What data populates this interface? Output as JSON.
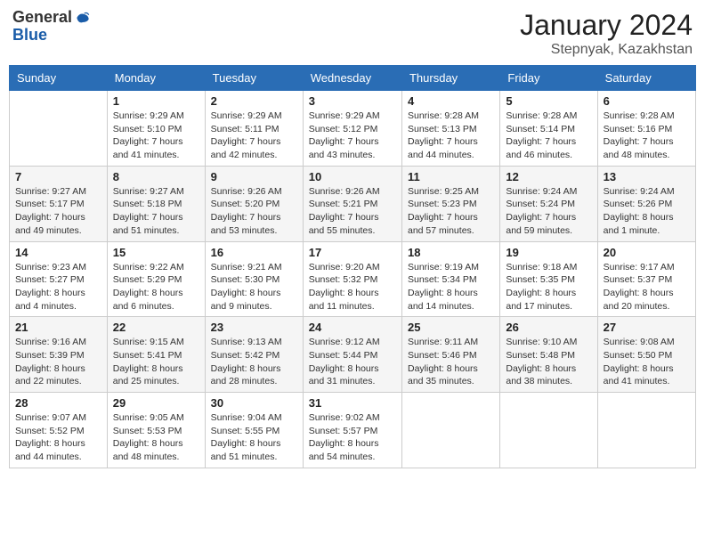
{
  "header": {
    "logo_general": "General",
    "logo_blue": "Blue",
    "month": "January 2024",
    "location": "Stepnyak, Kazakhstan"
  },
  "days_of_week": [
    "Sunday",
    "Monday",
    "Tuesday",
    "Wednesday",
    "Thursday",
    "Friday",
    "Saturday"
  ],
  "weeks": [
    [
      {
        "day": "",
        "sunrise": "",
        "sunset": "",
        "daylight": ""
      },
      {
        "day": "1",
        "sunrise": "Sunrise: 9:29 AM",
        "sunset": "Sunset: 5:10 PM",
        "daylight": "Daylight: 7 hours and 41 minutes."
      },
      {
        "day": "2",
        "sunrise": "Sunrise: 9:29 AM",
        "sunset": "Sunset: 5:11 PM",
        "daylight": "Daylight: 7 hours and 42 minutes."
      },
      {
        "day": "3",
        "sunrise": "Sunrise: 9:29 AM",
        "sunset": "Sunset: 5:12 PM",
        "daylight": "Daylight: 7 hours and 43 minutes."
      },
      {
        "day": "4",
        "sunrise": "Sunrise: 9:28 AM",
        "sunset": "Sunset: 5:13 PM",
        "daylight": "Daylight: 7 hours and 44 minutes."
      },
      {
        "day": "5",
        "sunrise": "Sunrise: 9:28 AM",
        "sunset": "Sunset: 5:14 PM",
        "daylight": "Daylight: 7 hours and 46 minutes."
      },
      {
        "day": "6",
        "sunrise": "Sunrise: 9:28 AM",
        "sunset": "Sunset: 5:16 PM",
        "daylight": "Daylight: 7 hours and 48 minutes."
      }
    ],
    [
      {
        "day": "7",
        "sunrise": "Sunrise: 9:27 AM",
        "sunset": "Sunset: 5:17 PM",
        "daylight": "Daylight: 7 hours and 49 minutes."
      },
      {
        "day": "8",
        "sunrise": "Sunrise: 9:27 AM",
        "sunset": "Sunset: 5:18 PM",
        "daylight": "Daylight: 7 hours and 51 minutes."
      },
      {
        "day": "9",
        "sunrise": "Sunrise: 9:26 AM",
        "sunset": "Sunset: 5:20 PM",
        "daylight": "Daylight: 7 hours and 53 minutes."
      },
      {
        "day": "10",
        "sunrise": "Sunrise: 9:26 AM",
        "sunset": "Sunset: 5:21 PM",
        "daylight": "Daylight: 7 hours and 55 minutes."
      },
      {
        "day": "11",
        "sunrise": "Sunrise: 9:25 AM",
        "sunset": "Sunset: 5:23 PM",
        "daylight": "Daylight: 7 hours and 57 minutes."
      },
      {
        "day": "12",
        "sunrise": "Sunrise: 9:24 AM",
        "sunset": "Sunset: 5:24 PM",
        "daylight": "Daylight: 7 hours and 59 minutes."
      },
      {
        "day": "13",
        "sunrise": "Sunrise: 9:24 AM",
        "sunset": "Sunset: 5:26 PM",
        "daylight": "Daylight: 8 hours and 1 minute."
      }
    ],
    [
      {
        "day": "14",
        "sunrise": "Sunrise: 9:23 AM",
        "sunset": "Sunset: 5:27 PM",
        "daylight": "Daylight: 8 hours and 4 minutes."
      },
      {
        "day": "15",
        "sunrise": "Sunrise: 9:22 AM",
        "sunset": "Sunset: 5:29 PM",
        "daylight": "Daylight: 8 hours and 6 minutes."
      },
      {
        "day": "16",
        "sunrise": "Sunrise: 9:21 AM",
        "sunset": "Sunset: 5:30 PM",
        "daylight": "Daylight: 8 hours and 9 minutes."
      },
      {
        "day": "17",
        "sunrise": "Sunrise: 9:20 AM",
        "sunset": "Sunset: 5:32 PM",
        "daylight": "Daylight: 8 hours and 11 minutes."
      },
      {
        "day": "18",
        "sunrise": "Sunrise: 9:19 AM",
        "sunset": "Sunset: 5:34 PM",
        "daylight": "Daylight: 8 hours and 14 minutes."
      },
      {
        "day": "19",
        "sunrise": "Sunrise: 9:18 AM",
        "sunset": "Sunset: 5:35 PM",
        "daylight": "Daylight: 8 hours and 17 minutes."
      },
      {
        "day": "20",
        "sunrise": "Sunrise: 9:17 AM",
        "sunset": "Sunset: 5:37 PM",
        "daylight": "Daylight: 8 hours and 20 minutes."
      }
    ],
    [
      {
        "day": "21",
        "sunrise": "Sunrise: 9:16 AM",
        "sunset": "Sunset: 5:39 PM",
        "daylight": "Daylight: 8 hours and 22 minutes."
      },
      {
        "day": "22",
        "sunrise": "Sunrise: 9:15 AM",
        "sunset": "Sunset: 5:41 PM",
        "daylight": "Daylight: 8 hours and 25 minutes."
      },
      {
        "day": "23",
        "sunrise": "Sunrise: 9:13 AM",
        "sunset": "Sunset: 5:42 PM",
        "daylight": "Daylight: 8 hours and 28 minutes."
      },
      {
        "day": "24",
        "sunrise": "Sunrise: 9:12 AM",
        "sunset": "Sunset: 5:44 PM",
        "daylight": "Daylight: 8 hours and 31 minutes."
      },
      {
        "day": "25",
        "sunrise": "Sunrise: 9:11 AM",
        "sunset": "Sunset: 5:46 PM",
        "daylight": "Daylight: 8 hours and 35 minutes."
      },
      {
        "day": "26",
        "sunrise": "Sunrise: 9:10 AM",
        "sunset": "Sunset: 5:48 PM",
        "daylight": "Daylight: 8 hours and 38 minutes."
      },
      {
        "day": "27",
        "sunrise": "Sunrise: 9:08 AM",
        "sunset": "Sunset: 5:50 PM",
        "daylight": "Daylight: 8 hours and 41 minutes."
      }
    ],
    [
      {
        "day": "28",
        "sunrise": "Sunrise: 9:07 AM",
        "sunset": "Sunset: 5:52 PM",
        "daylight": "Daylight: 8 hours and 44 minutes."
      },
      {
        "day": "29",
        "sunrise": "Sunrise: 9:05 AM",
        "sunset": "Sunset: 5:53 PM",
        "daylight": "Daylight: 8 hours and 48 minutes."
      },
      {
        "day": "30",
        "sunrise": "Sunrise: 9:04 AM",
        "sunset": "Sunset: 5:55 PM",
        "daylight": "Daylight: 8 hours and 51 minutes."
      },
      {
        "day": "31",
        "sunrise": "Sunrise: 9:02 AM",
        "sunset": "Sunset: 5:57 PM",
        "daylight": "Daylight: 8 hours and 54 minutes."
      },
      {
        "day": "",
        "sunrise": "",
        "sunset": "",
        "daylight": ""
      },
      {
        "day": "",
        "sunrise": "",
        "sunset": "",
        "daylight": ""
      },
      {
        "day": "",
        "sunrise": "",
        "sunset": "",
        "daylight": ""
      }
    ]
  ]
}
